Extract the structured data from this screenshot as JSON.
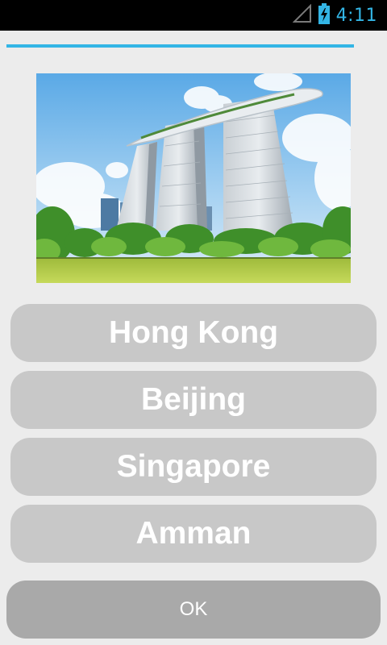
{
  "status_bar": {
    "time": "4:11",
    "icons": [
      "signal-icon",
      "battery-charging-icon"
    ]
  },
  "quiz": {
    "progress": 1.0,
    "image": "photo-marina-bay-sands",
    "options": [
      {
        "label": "Hong Kong"
      },
      {
        "label": "Beijing"
      },
      {
        "label": "Singapore"
      },
      {
        "label": "Amman"
      }
    ],
    "ok_label": "OK"
  },
  "colors": {
    "accent": "#33b5e5",
    "option_bg": "#c8c8c8",
    "ok_bg": "#a9a9a9",
    "background": "#ececec"
  }
}
